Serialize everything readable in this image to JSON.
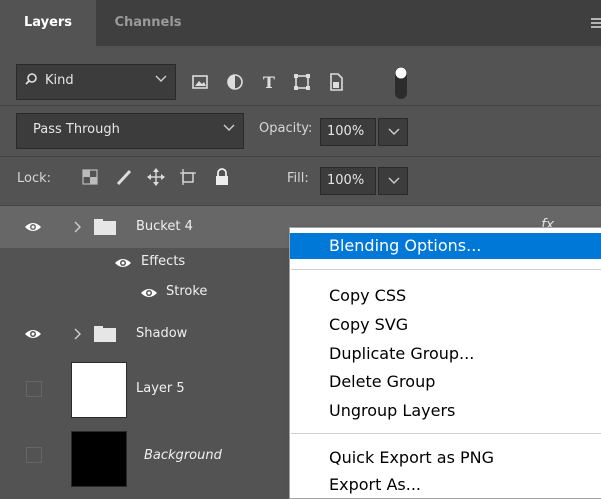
{
  "tabs": [
    {
      "label": "Layers",
      "active": true
    },
    {
      "label": "Channels",
      "active": false
    }
  ],
  "filter": {
    "kind_label": "Kind",
    "icons": [
      "magnifier-icon",
      "image-filter-icon",
      "adjustment-filter-icon",
      "type-filter-icon",
      "shape-filter-icon",
      "smart-object-filter-icon",
      "filter-toggle-icon"
    ]
  },
  "blend": {
    "mode": "Pass Through",
    "opacity_label": "Opacity:",
    "opacity_value": "100%"
  },
  "lock": {
    "label": "Lock:",
    "icons": [
      "lock-transparent-pixels-icon",
      "lock-image-pixels-icon",
      "lock-position-icon",
      "lock-artboard-icon",
      "lock-all-icon"
    ],
    "fill_label": "Fill:",
    "fill_value": "100%"
  },
  "layers": [
    {
      "name": "Bucket 4",
      "type": "group",
      "visible": true,
      "selected": true,
      "fx": "fx"
    },
    {
      "name": "Effects",
      "type": "effects-header",
      "visible": true
    },
    {
      "name": "Stroke",
      "type": "effect",
      "visible": true
    },
    {
      "name": "Shadow",
      "type": "group",
      "visible": true
    },
    {
      "name": "Layer 5",
      "type": "pixel",
      "visible": false
    },
    {
      "name": "Background",
      "type": "background",
      "visible": false
    }
  ],
  "context_menu": {
    "items": [
      {
        "label": "Blending Options...",
        "highlighted": true
      },
      {
        "label": "Copy CSS"
      },
      {
        "label": "Copy SVG"
      },
      {
        "label": "Duplicate Group..."
      },
      {
        "label": "Delete Group"
      },
      {
        "label": "Ungroup Layers"
      },
      {
        "label": "Quick Export as PNG"
      },
      {
        "label": "Export As..."
      }
    ]
  },
  "colors": {
    "panel_bg": "#535353",
    "tabbar_bg": "#3f3f3f",
    "selected_row": "#676767",
    "menu_highlight": "#0078d7"
  }
}
